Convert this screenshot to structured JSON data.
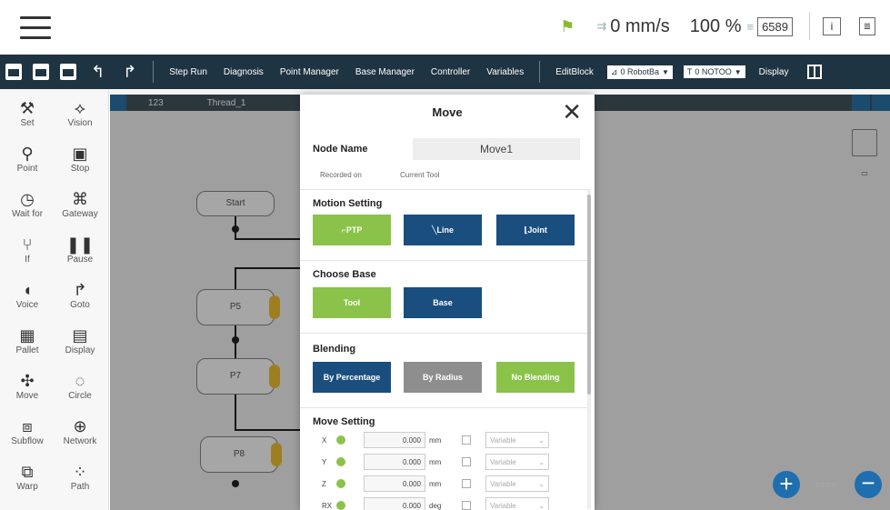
{
  "status": {
    "speed": "0 mm/s",
    "percent": "100 %",
    "count": "6589"
  },
  "toolbar": {
    "items": [
      "Step Run",
      "Diagnosis",
      "Point Manager",
      "Base Manager",
      "Controller",
      "Variables"
    ],
    "editblock": "EditBlock",
    "dd1": "0 RobotBa",
    "dd2": "0 NOTOO",
    "display": "Display"
  },
  "sidebar": {
    "items": [
      {
        "label": "Set",
        "icon": "wrench-icon"
      },
      {
        "label": "Vision",
        "icon": "vision-icon"
      },
      {
        "label": "Point",
        "icon": "point-icon"
      },
      {
        "label": "Stop",
        "icon": "stop-icon"
      },
      {
        "label": "Wait for",
        "icon": "clock-icon"
      },
      {
        "label": "Gateway",
        "icon": "gateway-icon"
      },
      {
        "label": "If",
        "icon": "if-icon"
      },
      {
        "label": "Pause",
        "icon": "pause-icon"
      },
      {
        "label": "Voice",
        "icon": "voice-icon"
      },
      {
        "label": "Goto",
        "icon": "goto-icon"
      },
      {
        "label": "Pallet",
        "icon": "pallet-icon"
      },
      {
        "label": "Display",
        "icon": "display-icon"
      },
      {
        "label": "Move",
        "icon": "move-icon"
      },
      {
        "label": "Circle",
        "icon": "circle-icon"
      },
      {
        "label": "Subflow",
        "icon": "subflow-icon"
      },
      {
        "label": "Network",
        "icon": "network-icon"
      },
      {
        "label": "Warp",
        "icon": "warp-icon"
      },
      {
        "label": "Path",
        "icon": "path-icon"
      }
    ]
  },
  "tabs": [
    "123",
    "Thread_1"
  ],
  "flow": {
    "start": "Start",
    "nodes": [
      "P5",
      "P7",
      "P8"
    ]
  },
  "zoom": {
    "label": "zoom"
  },
  "modal": {
    "title": "Move",
    "node_name_label": "Node Name",
    "node_name_value": "Move1",
    "recorded_on": "Recorded on",
    "current_tool": "Current Tool",
    "motion_setting": "Motion Setting",
    "motion_buttons": [
      "PTP",
      "Line",
      "Joint"
    ],
    "choose_base": "Choose Base",
    "base_buttons": [
      "Tool",
      "Base"
    ],
    "blending": "Blending",
    "blending_buttons": [
      "By Percentage",
      "By Radius",
      "No Blending"
    ],
    "move_setting": "Move Setting",
    "rows": [
      {
        "axis": "X",
        "value": "0.000",
        "unit": "mm",
        "select": "Variable"
      },
      {
        "axis": "Y",
        "value": "0.000",
        "unit": "mm",
        "select": "Variable"
      },
      {
        "axis": "Z",
        "value": "0.000",
        "unit": "mm",
        "select": "Variable"
      },
      {
        "axis": "RX",
        "value": "0.000",
        "unit": "deg",
        "select": "Variable"
      }
    ]
  }
}
